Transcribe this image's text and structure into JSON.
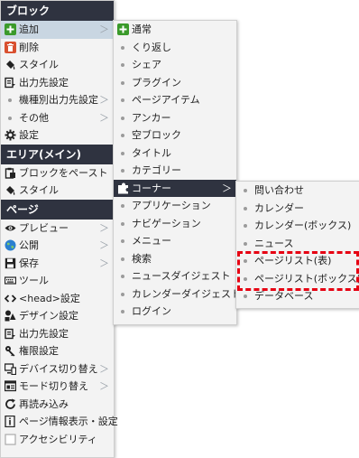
{
  "menu1": {
    "sections": [
      {
        "title": "ブロック",
        "items": [
          {
            "label": "追加",
            "icon": "plus-icon",
            "arrow": "＞",
            "state": "highlight"
          },
          {
            "label": "削除",
            "icon": "trash-icon"
          },
          {
            "label": "スタイル",
            "icon": "paint-bucket-icon"
          },
          {
            "label": "出力先設定",
            "icon": "output-icon"
          },
          {
            "label": "機種別出力先設定",
            "icon": "dot",
            "arrow": "＞"
          },
          {
            "label": "その他",
            "icon": "dot",
            "arrow": "＞"
          },
          {
            "label": "設定",
            "icon": "gear-icon"
          }
        ]
      },
      {
        "title": "エリア(メイン)",
        "items": [
          {
            "label": "ブロックをペースト",
            "icon": "paste-icon"
          },
          {
            "label": "スタイル",
            "icon": "paint-bucket-icon"
          }
        ]
      },
      {
        "title": "ページ",
        "items": [
          {
            "label": "プレビュー",
            "icon": "eye-icon",
            "arrow": "＞"
          },
          {
            "label": "公開",
            "icon": "globe-icon",
            "arrow": "＞"
          },
          {
            "label": "保存",
            "icon": "save-icon",
            "arrow": "＞"
          },
          {
            "label": "ツール",
            "icon": "keyboard-icon"
          },
          {
            "label": "<head>設定",
            "icon": "code-icon"
          },
          {
            "label": "デザイン設定",
            "icon": "design-icon"
          },
          {
            "label": "出力先設定",
            "icon": "output-icon"
          },
          {
            "label": "権限設定",
            "icon": "key-icon"
          },
          {
            "label": "デバイス切り替え",
            "icon": "device-icon",
            "arrow": "＞"
          },
          {
            "label": "モード切り替え",
            "icon": "mode-icon",
            "arrow": "＞"
          },
          {
            "label": "再読み込み",
            "icon": "reload-icon"
          },
          {
            "label": "ページ情報表示・設定",
            "icon": "info-icon"
          },
          {
            "label": "アクセシビリティ",
            "icon": "checkbox-icon"
          }
        ]
      }
    ]
  },
  "menu2": {
    "items": [
      {
        "label": "通常",
        "icon": "plus-icon"
      },
      {
        "label": "くり返し",
        "icon": "dot"
      },
      {
        "label": "シェア",
        "icon": "dot"
      },
      {
        "label": "プラグイン",
        "icon": "dot"
      },
      {
        "label": "ページアイテム",
        "icon": "dot"
      },
      {
        "label": "アンカー",
        "icon": "dot"
      },
      {
        "label": "空ブロック",
        "icon": "dot"
      },
      {
        "label": "タイトル",
        "icon": "dot"
      },
      {
        "label": "カテゴリー",
        "icon": "dot"
      },
      {
        "label": "コーナー",
        "icon": "puzzle-icon",
        "arrow": "＞",
        "state": "highlight-dark"
      },
      {
        "label": "アプリケーション",
        "icon": "dot"
      },
      {
        "label": "ナビゲーション",
        "icon": "dot"
      },
      {
        "label": "メニュー",
        "icon": "dot"
      },
      {
        "label": "検索",
        "icon": "dot"
      },
      {
        "label": "ニュースダイジェスト",
        "icon": "dot"
      },
      {
        "label": "カレンダーダイジェスト",
        "icon": "dot"
      },
      {
        "label": "ログイン",
        "icon": "dot"
      }
    ]
  },
  "menu3": {
    "items": [
      {
        "label": "問い合わせ",
        "icon": "dot"
      },
      {
        "label": "カレンダー",
        "icon": "dot"
      },
      {
        "label": "カレンダー(ボックス)",
        "icon": "dot"
      },
      {
        "label": "ニュース",
        "icon": "dot"
      },
      {
        "label": "ページリスト(表)",
        "icon": "dot"
      },
      {
        "label": "ページリスト(ボックス)",
        "icon": "dot"
      },
      {
        "label": "データベース",
        "icon": "dot"
      }
    ]
  },
  "colors": {
    "header_bg": "#2f3340",
    "highlight_bg": "#c9d6e2",
    "menu_bg": "#f3f3f3",
    "dash_red": "#e60012",
    "plus_green": "#3a9a2a",
    "delete_red": "#d9502f",
    "globe_blue": "#2a7fd0"
  }
}
